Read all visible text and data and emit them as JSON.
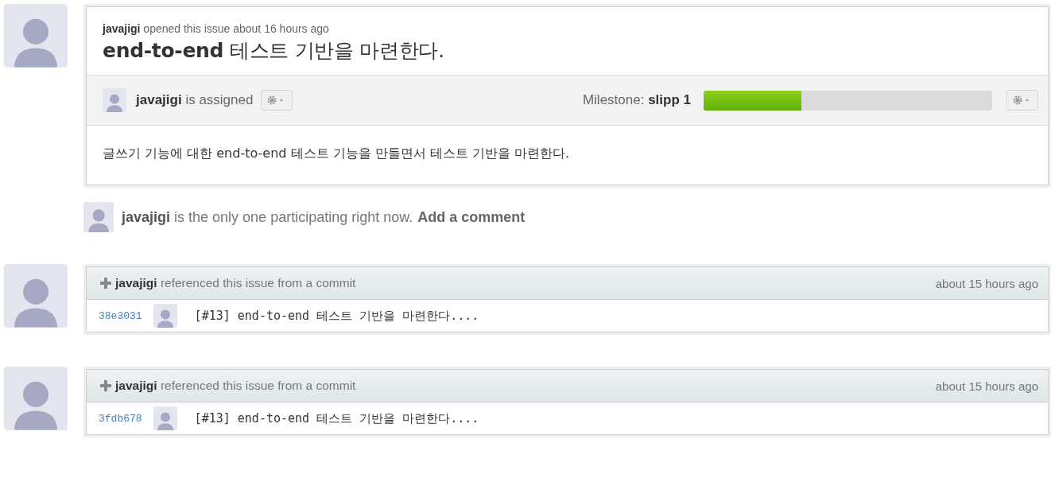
{
  "issue": {
    "author": "javajigi",
    "opened_text": "opened this issue about 16 hours ago",
    "title": "**end-to-end** 테스트 기반을 마련한다.",
    "assignee": "javajigi",
    "assigned_text": "is assigned",
    "milestone_label": "Milestone:",
    "milestone_name": "slipp 1",
    "milestone_progress": {
      "level": 0.34
    },
    "body": "글쓰기 기능에 대한 end-to-end 테스트 기능을 만들면서 테스트 기반을 마련한다."
  },
  "participation": {
    "user": "javajigi",
    "text": "is the only one participating right now.",
    "link": "Add a comment"
  },
  "events": [
    {
      "user": "javajigi",
      "text": "referenced this issue from a commit",
      "time": "about 15 hours ago",
      "sha": "38e3031",
      "message": "[#13] end-to-end 테스트 기반을 마련한다...."
    },
    {
      "user": "javajigi",
      "text": "referenced this issue from a commit",
      "time": "about 15 hours ago",
      "sha": "3fdb678",
      "message": "[#13] end-to-end 테스트 기반을 마련한다...."
    }
  ]
}
